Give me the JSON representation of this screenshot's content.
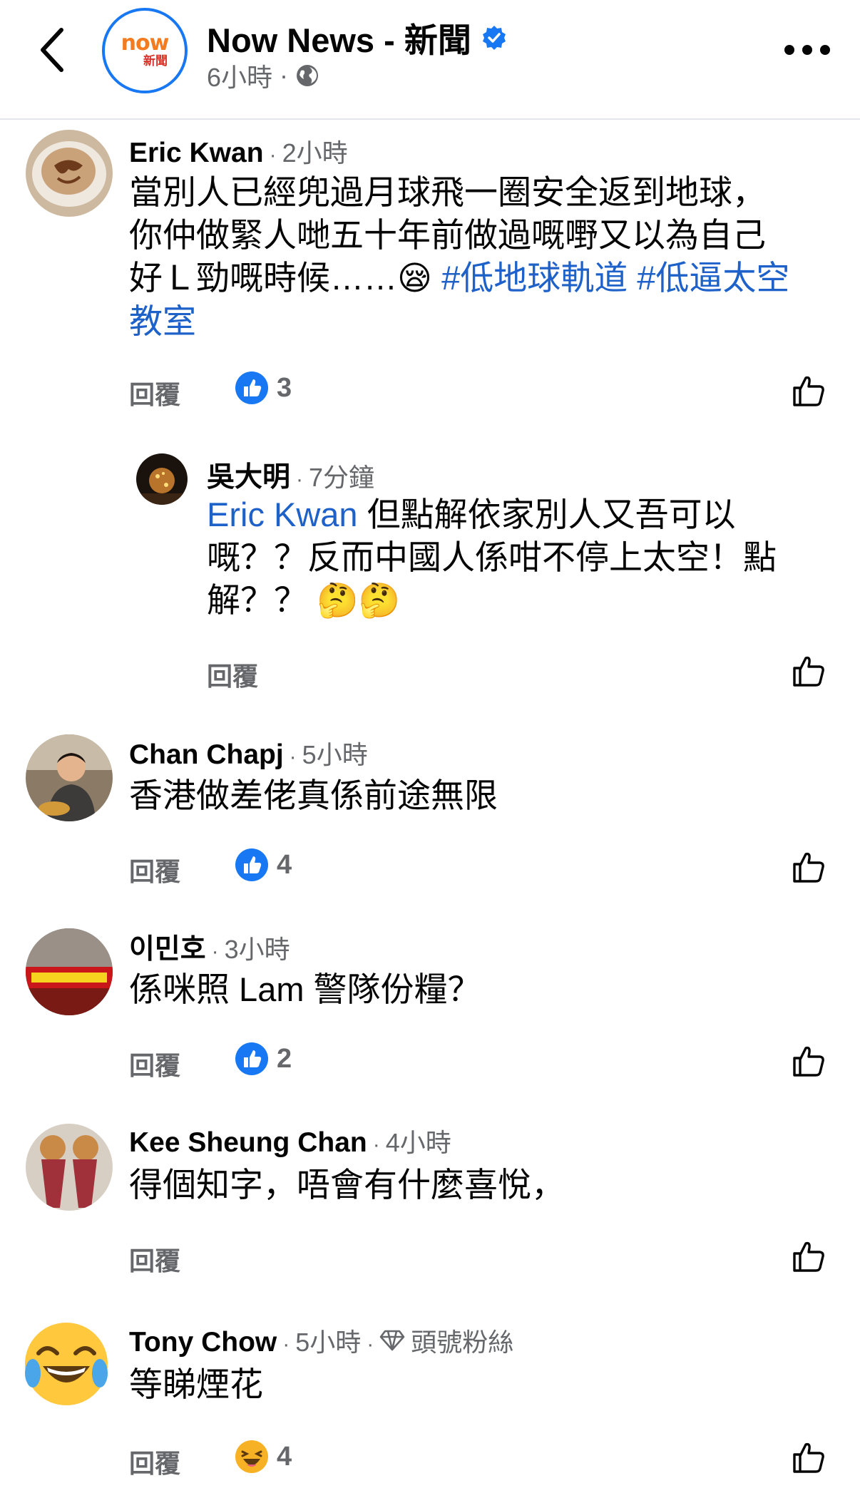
{
  "header": {
    "page_name": "Now News - 新聞",
    "logo_text": "now",
    "logo_sub": "新聞",
    "post_time": "6小時",
    "dot": "·"
  },
  "comments": [
    {
      "name": "Eric Kwan",
      "time": "2小時",
      "text_lines": [
        "當別人已經兜過月球飛一圈安全返到地球，",
        "你仲做緊人哋五十年前做過嘅嘢又以為自己"
      ],
      "text_line3_prefix": "好Ｌ勁嘅時候……",
      "hashtag1": "#低地球軌道",
      "hashtag2": "#低逼太空",
      "hashtag2_cont": "教室",
      "reply_label": "回覆",
      "reaction_count": "3"
    },
    {
      "name": "吳大明",
      "time": "7分鐘",
      "mention": "Eric Kwan",
      "text_after_mention": " 但點解依家別人又吾可以",
      "text_lines": [
        "嘅？？反而中國人係咁不停上太空！點",
        "解？？"
      ],
      "reply_label": "回覆"
    },
    {
      "name": "Chan Chapj",
      "time": "5小時",
      "text": "香港做差佬真係前途無限",
      "reply_label": "回覆",
      "reaction_count": "4"
    },
    {
      "name": "이민호",
      "time": "3小時",
      "text": "係咪照 Lam 警隊份糧？",
      "reply_label": "回覆",
      "reaction_count": "2"
    },
    {
      "name": "Kee Sheung Chan",
      "time": "4小時",
      "text": "得個知字，唔會有什麼喜悅，",
      "reply_label": "回覆"
    },
    {
      "name": "Tony Chow",
      "time": "5小時",
      "badge": "頭號粉絲",
      "text": "等睇煙花",
      "reply_label": "回覆",
      "reaction_count": "4"
    }
  ],
  "colors": {
    "facebook_blue": "#1877f2",
    "hashtag_blue": "#1d61c9",
    "meta_gray": "#65676b"
  }
}
